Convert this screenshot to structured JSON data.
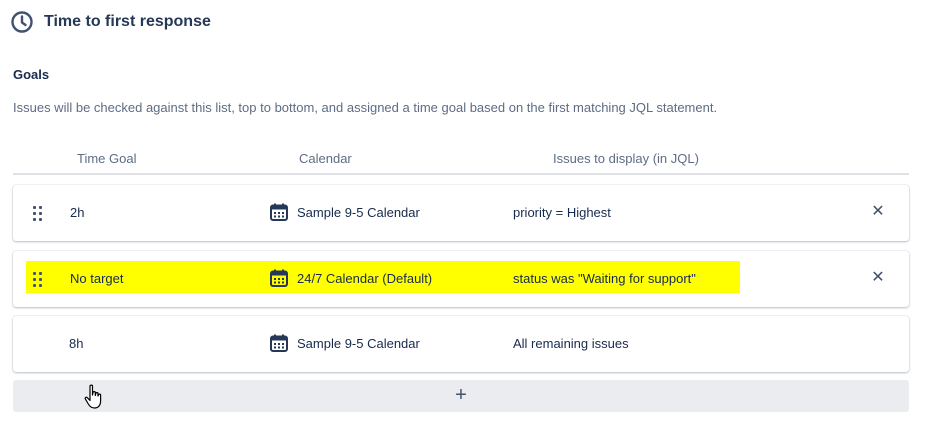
{
  "header": {
    "icon": "clock-icon",
    "title": "Time to first response"
  },
  "goals": {
    "label": "Goals",
    "description": "Issues will be checked against this list, top to bottom, and assigned a time goal based on the first matching JQL statement."
  },
  "columns": {
    "time_goal": "Time Goal",
    "calendar": "Calendar",
    "jql": "Issues to display (in JQL)"
  },
  "rows": [
    {
      "time_goal": "2h",
      "calendar": "Sample 9-5 Calendar",
      "jql": "priority = Highest",
      "removable": true,
      "highlighted": false
    },
    {
      "time_goal": "No target",
      "calendar": "24/7 Calendar (Default)",
      "jql": "status was \"Waiting for support\"",
      "removable": true,
      "highlighted": true
    },
    {
      "time_goal": "8h",
      "calendar": "Sample 9-5 Calendar",
      "jql": "All remaining issues",
      "removable": false,
      "highlighted": false
    }
  ],
  "add_button": {
    "label": "+"
  },
  "colors": {
    "highlight": "#ffff00",
    "text": "#172b4d",
    "muted": "#5e6c84",
    "icon": "#42526e"
  }
}
